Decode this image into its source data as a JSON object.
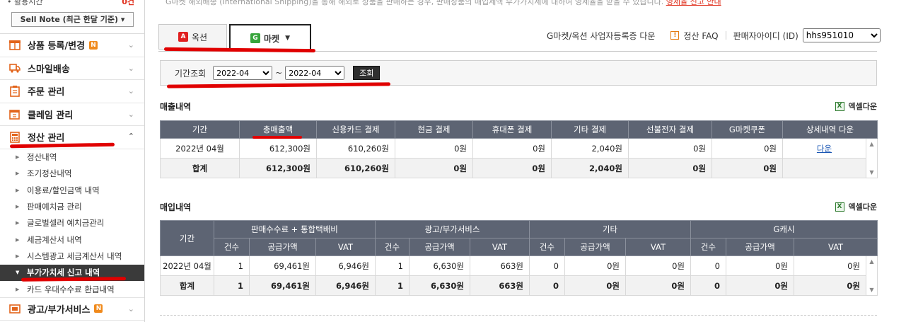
{
  "sidebar": {
    "usage_label": "• 활용시간",
    "usage_count": "0건",
    "sell_note": "Sell Note (최근 한달 기준) ▾",
    "menus": [
      {
        "label": "상품 등록/변경",
        "badge": "N"
      },
      {
        "label": "스마일배송",
        "badge": ""
      },
      {
        "label": "주문 관리",
        "badge": ""
      },
      {
        "label": "클레임 관리",
        "badge": ""
      },
      {
        "label": "정산 관리",
        "badge": ""
      },
      {
        "label": "광고/부가서비스",
        "badge": "N"
      }
    ],
    "sub_items": [
      "정산내역",
      "조기정산내역",
      "이용료/할인금액 내역",
      "판매예치금 관리",
      "글로벌셀러 예치금관리",
      "세금계산서 내역",
      "시스템광고 세금계산서 내역",
      "부가가치세 신고 내역",
      "카드 우대수수료 환급내역"
    ]
  },
  "notice": {
    "text": "G마켓 해외배송 (International Shipping)을 통해 해외로 상품을 판매하는 경우, 판매상품의 매입세액 부가가치세에 대하여 영세율을 받을 수 있습니다.",
    "link": "영세율 신고 안내"
  },
  "tabs": {
    "auction": "옥션",
    "gmarket": "마켓",
    "auction_logo": "A",
    "gmarket_logo": "G"
  },
  "toplinks": {
    "biz_reg": "G마켓/옥션 사업자등록증 다운",
    "faq": "정산 FAQ",
    "seller_id_label": "판매자아이디 (ID)",
    "seller_id_value": "hhs951010"
  },
  "search": {
    "label": "기간조회",
    "from": "2022-04",
    "tilde": "~",
    "to": "2022-04",
    "button": "조회"
  },
  "sales": {
    "title": "매출내역",
    "excel": "엑셀다운",
    "headers": [
      "기간",
      "총매출액",
      "신용카드 결제",
      "현금 결제",
      "휴대폰 결제",
      "기타 결제",
      "선불전자 결제",
      "G마켓쿠폰",
      "상세내역 다운"
    ],
    "row": [
      "2022년 04월",
      "612,300원",
      "610,260원",
      "0원",
      "0원",
      "2,040원",
      "0원",
      "0원",
      "다운"
    ],
    "total": [
      "합계",
      "612,300원",
      "610,260원",
      "0원",
      "0원",
      "2,040원",
      "0원",
      "0원"
    ]
  },
  "purchase": {
    "title": "매입내역",
    "excel": "엑셀다운",
    "period": "기간",
    "groups": [
      "판매수수료 + 통합택배비",
      "광고/부가서비스",
      "기타",
      "G캐시"
    ],
    "subheaders": [
      "건수",
      "공급가액",
      "VAT"
    ],
    "row": [
      "2022년 04월",
      "1",
      "69,461원",
      "6,946원",
      "1",
      "6,630원",
      "663원",
      "0",
      "0원",
      "0원",
      "0",
      "0원",
      "0원"
    ],
    "total": [
      "합계",
      "1",
      "69,461원",
      "6,946원",
      "1",
      "6,630원",
      "663원",
      "0",
      "0원",
      "0원",
      "0",
      "0원",
      "0원"
    ]
  },
  "colors": {
    "header_bg": "#5d6473",
    "annotation_red": "#e00000",
    "active_menu_bg": "#3a3a3a"
  }
}
